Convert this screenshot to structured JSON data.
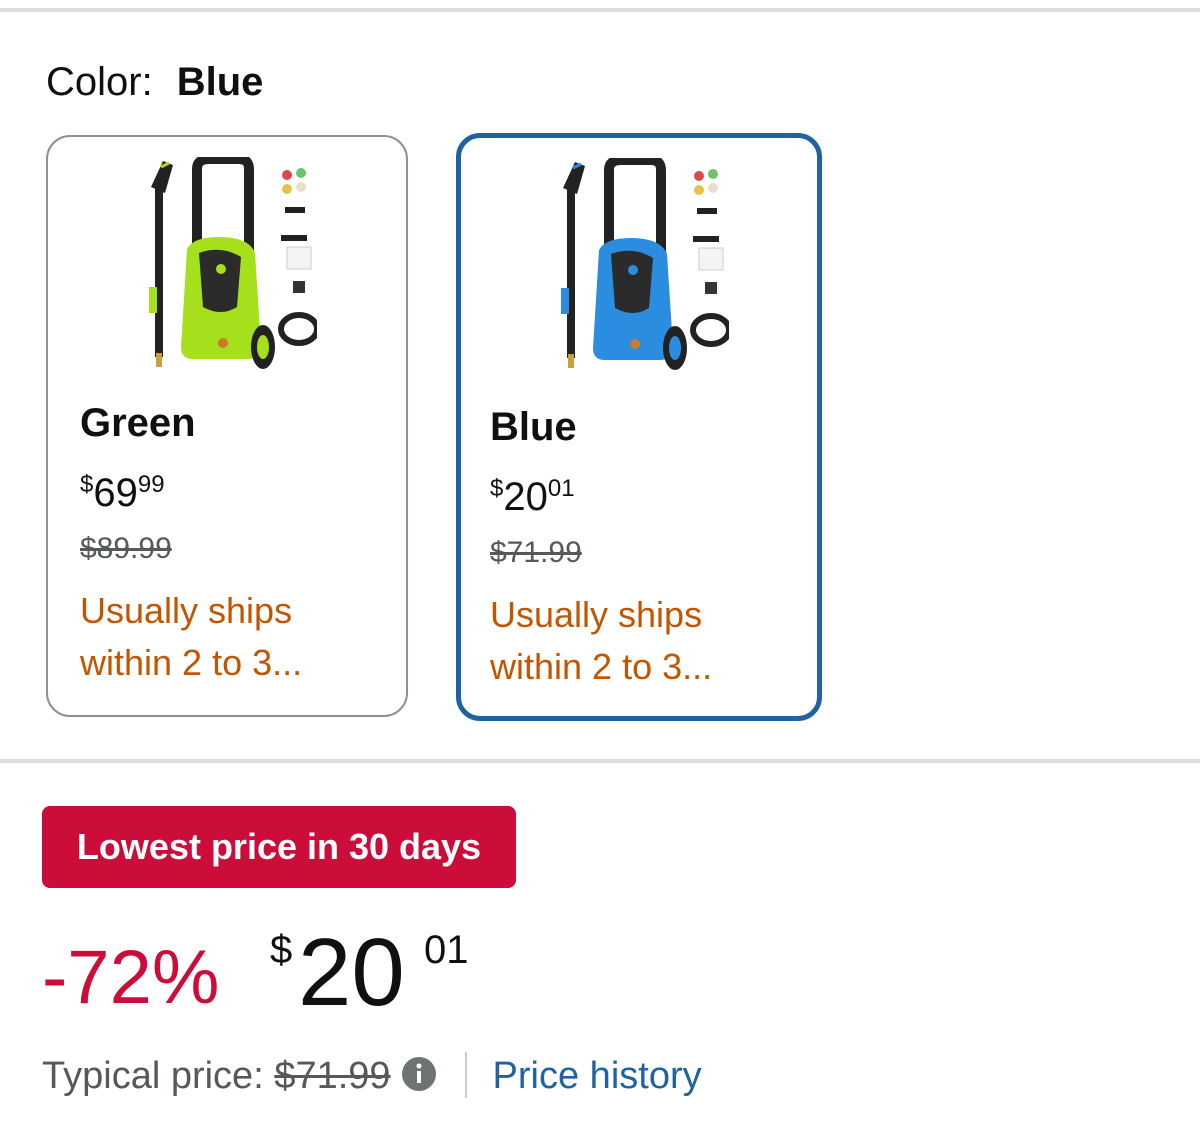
{
  "color_selector": {
    "label": "Color:",
    "selected": "Blue"
  },
  "variants": [
    {
      "name": "Green",
      "price_symbol": "$",
      "price_whole": "69",
      "price_cents": "99",
      "list_price": "$89.99",
      "shipping": "Usually ships within 2 to 3...",
      "selected": false,
      "body_color": "#a6e01c"
    },
    {
      "name": "Blue",
      "price_symbol": "$",
      "price_whole": "20",
      "price_cents": "01",
      "list_price": "$71.99",
      "shipping": "Usually ships within 2 to 3...",
      "selected": true,
      "body_color": "#2a8de0"
    }
  ],
  "deal": {
    "badge": "Lowest price in 30 days",
    "badge_color": "#cc0c39"
  },
  "pricing": {
    "discount": "-72%",
    "symbol": "$",
    "whole": "20",
    "cents": "01",
    "typical_label": "Typical price:",
    "typical_value": "$71.99",
    "history_link": "Price history"
  },
  "colors": {
    "accent": "#2162a1",
    "ship_text": "#c45500",
    "deal_red": "#cc0c39"
  }
}
